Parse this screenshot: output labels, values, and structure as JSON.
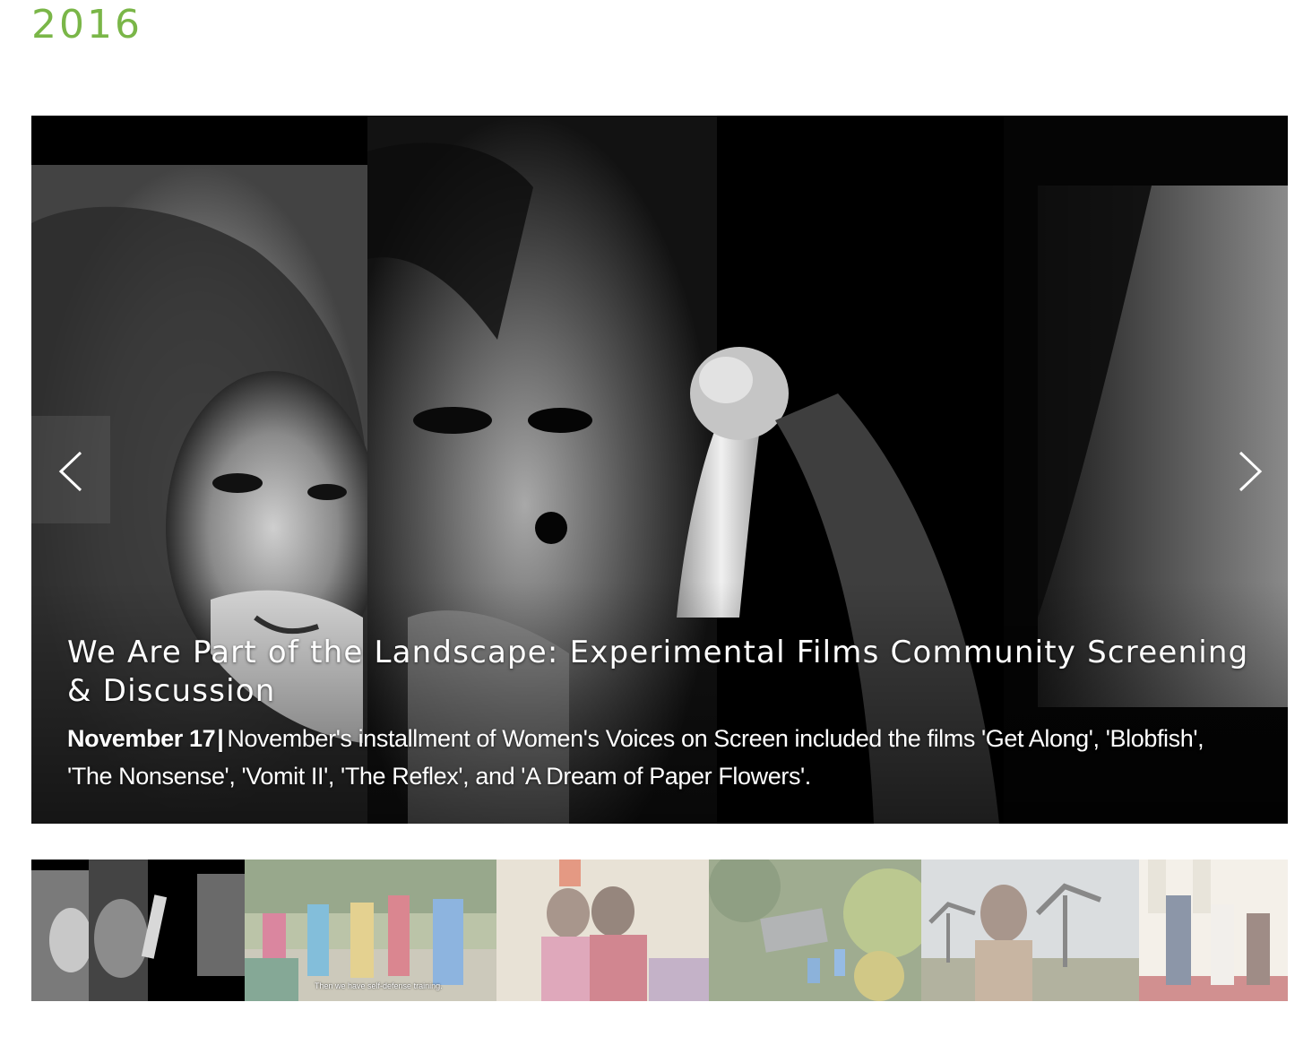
{
  "section": {
    "year": "2016"
  },
  "slideshow": {
    "current_slide": {
      "title": "We Are Part of the Landscape: Experimental Films Community Screening & Discussion",
      "date": "November 17",
      "separator": "|",
      "description": "November's installment of Women's Voices on Screen included the films 'Get Along', 'Blobfish', 'The Nonsense', 'Vomit II', 'The Reflex', and 'A Dream of Paper Flowers'."
    },
    "prev_icon": "chevron-left-icon",
    "next_icon": "chevron-right-icon"
  },
  "thumbnails": {
    "active_index": 0,
    "count": 6,
    "subtitle_caption": "Then we have self-defense training."
  },
  "colors": {
    "year_heading": "#7ab648",
    "hero_background": "#000000",
    "caption_text": "#ffffff"
  }
}
